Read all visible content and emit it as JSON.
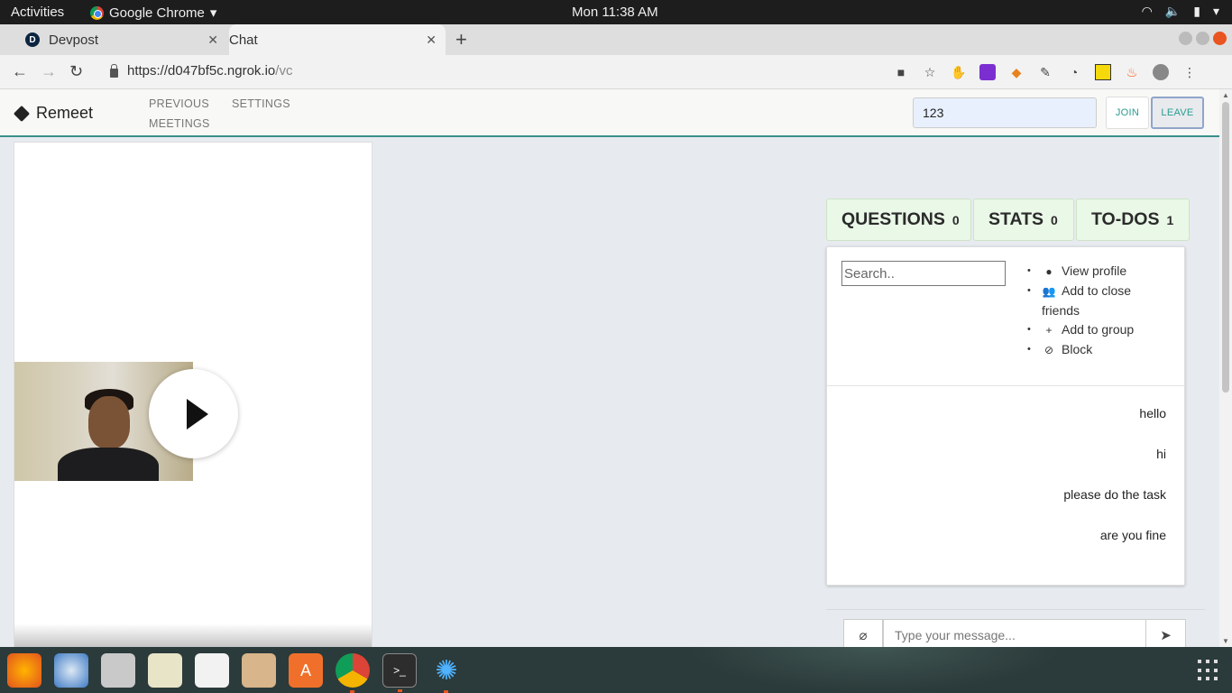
{
  "os": {
    "activities": "Activities",
    "app_name": "Google Chrome",
    "clock": "Mon 11:38 AM"
  },
  "browser": {
    "tabs": [
      {
        "title": "Devpost",
        "favicon": "D"
      },
      {
        "title": "Chat"
      }
    ],
    "url_host": "https://d047bf5c.ngrok.io",
    "url_path": "/vc"
  },
  "app": {
    "brand": "Remeet",
    "nav": {
      "previous_meetings": "PREVIOUS MEETINGS",
      "settings": "SETTINGS"
    },
    "room_value": "123",
    "join_label": "JOIN",
    "leave_label": "LEAVE"
  },
  "panel": {
    "tabs": [
      {
        "label": "QUESTIONS",
        "count": "0"
      },
      {
        "label": "STATS",
        "count": "0"
      },
      {
        "label": "TO-DOS",
        "count": "1"
      }
    ],
    "search_placeholder": "Search..",
    "menu": [
      {
        "label": "View profile",
        "icon": "user-circle-icon"
      },
      {
        "label": "Add to close friends",
        "icon": "users-icon"
      },
      {
        "label": "Add to group",
        "icon": "plus-icon"
      },
      {
        "label": "Block",
        "icon": "ban-icon"
      }
    ],
    "messages": [
      "hello",
      "hi",
      "please do the task",
      "are you fine"
    ],
    "composer_placeholder": "Type your message..."
  },
  "colors": {
    "accent": "#2a9d8f",
    "tab_bg": "#eaf8e7",
    "room_input_bg": "#e8f0fe",
    "ubuntu_orange": "#e95420"
  }
}
